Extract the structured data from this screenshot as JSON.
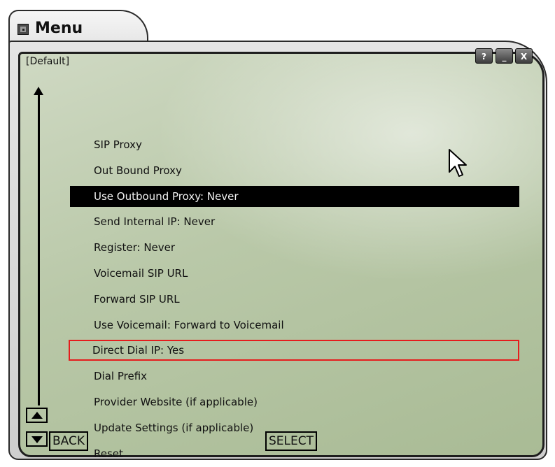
{
  "window": {
    "title": "Menu",
    "panel_label": "[Default]",
    "buttons": {
      "help": "?",
      "minimize": "_",
      "close": "X"
    }
  },
  "menu": {
    "items": [
      {
        "label": "SIP Proxy",
        "state": "normal"
      },
      {
        "label": "Out Bound Proxy",
        "state": "normal"
      },
      {
        "label": "Use Outbound Proxy: Never",
        "state": "selected"
      },
      {
        "label": "Send Internal IP: Never",
        "state": "normal"
      },
      {
        "label": "Register: Never",
        "state": "normal"
      },
      {
        "label": "Voicemail SIP URL",
        "state": "normal"
      },
      {
        "label": "Forward SIP URL",
        "state": "normal"
      },
      {
        "label": "Use Voicemail: Forward to Voicemail",
        "state": "normal"
      },
      {
        "label": "Direct Dial IP: Yes",
        "state": "highlighted"
      },
      {
        "label": "Dial Prefix",
        "state": "normal"
      },
      {
        "label": "Provider Website (if applicable)",
        "state": "normal"
      },
      {
        "label": "Update Settings (if applicable)",
        "state": "normal"
      },
      {
        "label": "Reset",
        "state": "normal"
      }
    ]
  },
  "softkeys": {
    "back": "BACK",
    "select": "SELECT"
  },
  "colors": {
    "panel": "#b9c8a8",
    "selected_bg": "#000000",
    "selected_text": "#f2f2f2",
    "highlight_border": "#e51d1d"
  },
  "icons": {
    "title": "menu-window-icon",
    "scroll_up": "triangle-up-icon",
    "scroll_down": "triangle-down-icon",
    "cursor": "mouse-pointer-icon"
  }
}
